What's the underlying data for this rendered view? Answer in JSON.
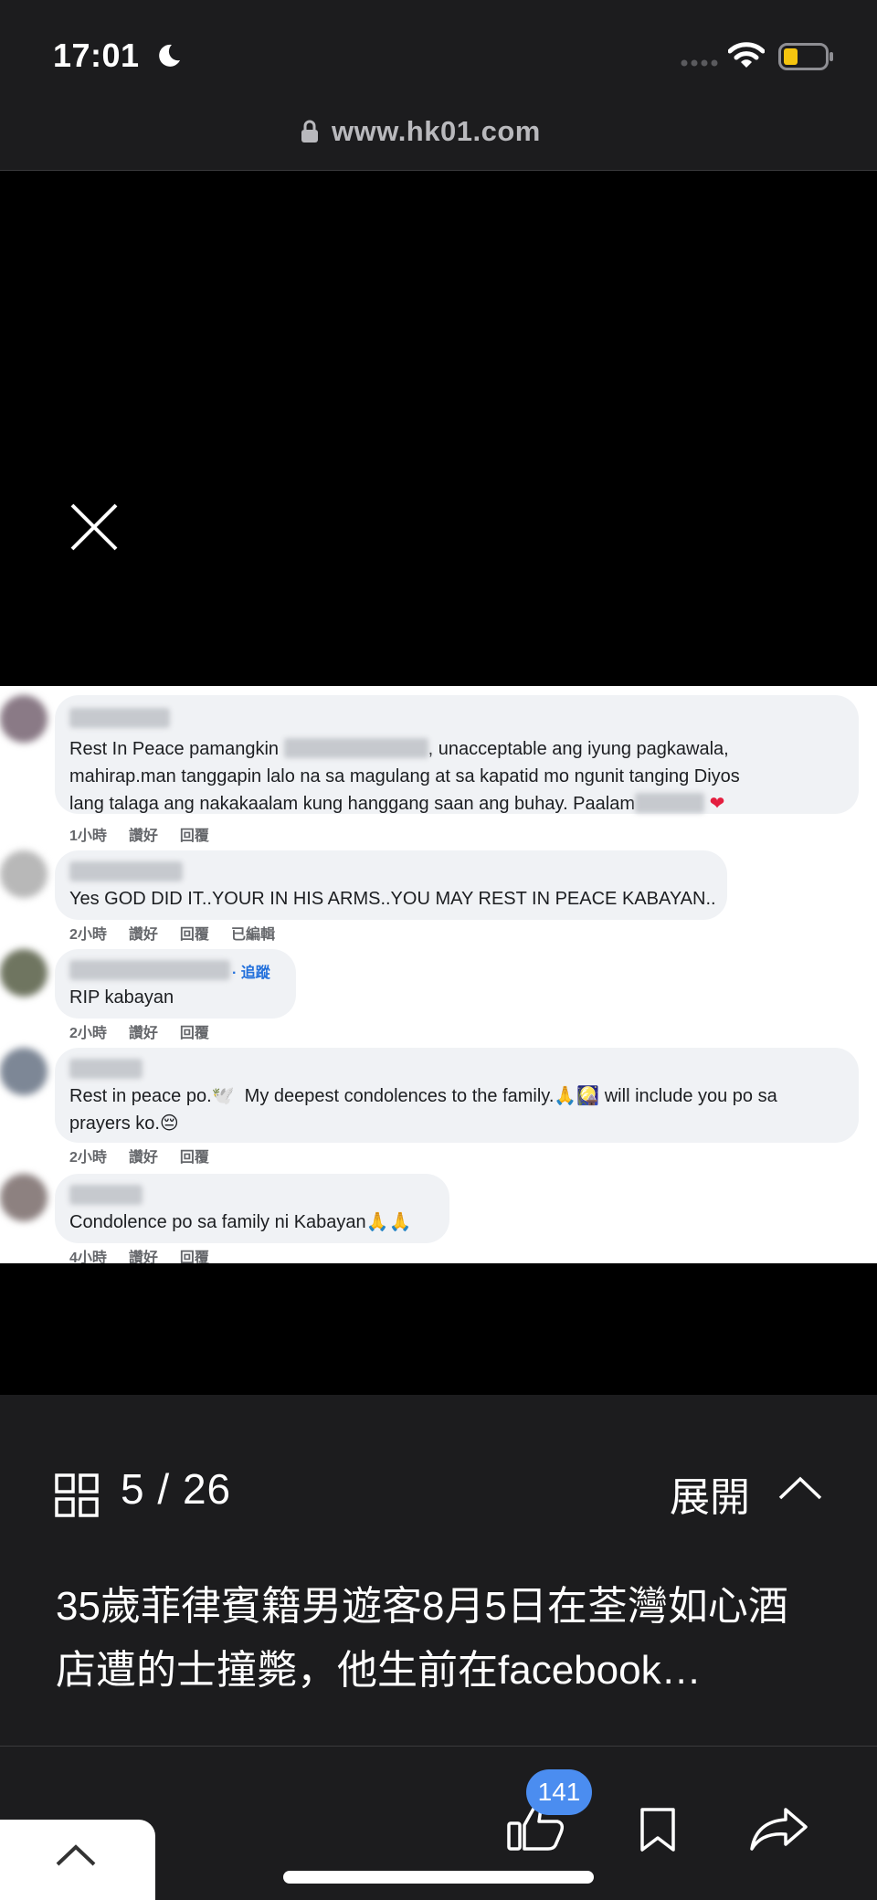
{
  "status": {
    "time": "17:01"
  },
  "browser": {
    "url": "www.hk01.com"
  },
  "comments": [
    {
      "lines": [
        "Rest In Peace pamangkin ",
        ", unacceptable ang iyung pagkawala,",
        "mahirap.man tanggapin lalo na sa magulang at sa kapatid mo ngunit tanging Diyos",
        "lang talaga ang nakakaalam kung hanggang saan ang buhay. Paalam"
      ],
      "time": "1小時",
      "like": "讚好",
      "reply": "回覆"
    },
    {
      "lines": [
        "Yes GOD DID IT..YOUR IN HIS ARMS..YOU MAY REST IN PEACE KABAYAN.."
      ],
      "time": "2小時",
      "like": "讚好",
      "reply": "回覆",
      "edited": "已編輯"
    },
    {
      "lines": [
        "RIP kabayan"
      ],
      "follow": "· 追蹤",
      "time": "2小時",
      "like": "讚好",
      "reply": "回覆"
    },
    {
      "lines": [
        "Rest in peace po.🕊️  My deepest condolences to the family.🙏🎑 will include you po sa",
        "prayers ko.😔"
      ],
      "time": "2小時",
      "like": "讚好",
      "reply": "回覆"
    },
    {
      "lines": [
        "Condolence po sa family ni Kabayan🙏🙏"
      ],
      "time": "4小時",
      "like": "讚好",
      "reply": "回覆"
    }
  ],
  "viewer": {
    "current": "5",
    "separator": "/",
    "total": "26",
    "expand_label": "展開",
    "caption": "35歲菲律賓籍男遊客8月5日在荃灣如心酒店遭的士撞斃，他生前在facebook…"
  },
  "toolbar": {
    "like_count": "141"
  },
  "icons": [
    "moon-icon",
    "signal-icon",
    "wifi-icon",
    "battery-icon",
    "lock-icon",
    "close-icon",
    "grid-icon",
    "chevron-up-icon",
    "like-icon",
    "bookmark-icon",
    "share-icon"
  ],
  "colors": {
    "accent": "#4b8df0",
    "battery": "#f5c40f",
    "follow": "#216fdb"
  }
}
